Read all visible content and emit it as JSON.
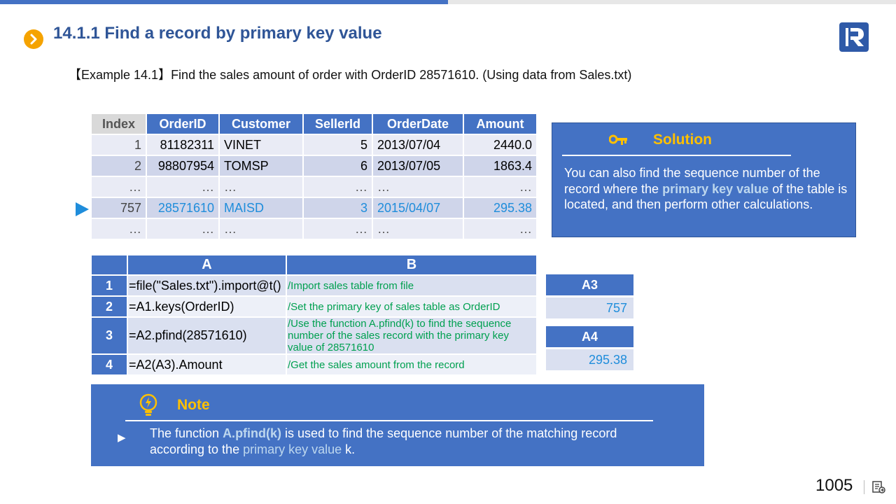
{
  "page": {
    "title": "14.1.1 Find a record by primary key value",
    "example": "【Example 14.1】Find the sales amount of order with OrderID 28571610. (Using data from Sales.txt)",
    "page_number": "1005"
  },
  "data_table": {
    "headers": [
      "Index",
      "OrderID",
      "Customer",
      "SellerId",
      "OrderDate",
      "Amount"
    ],
    "rows": [
      [
        "1",
        "81182311",
        "VINET",
        "5",
        "2013/07/04",
        "2440.0"
      ],
      [
        "2",
        "98807954",
        "TOMSP",
        "6",
        "2013/07/05",
        "1863.4"
      ],
      [
        "…",
        "…",
        "…",
        "…",
        "…",
        "…"
      ],
      [
        "757",
        "28571610",
        "MAISD",
        "3",
        "2015/04/07",
        "295.38"
      ],
      [
        "…",
        "…",
        "…",
        "…",
        "…",
        "…"
      ]
    ]
  },
  "solution": {
    "title": "Solution",
    "text_before": "You can also find the sequence number of the record where the ",
    "highlight": "primary key value",
    "text_after": " of the table is located, and then perform other calculations."
  },
  "code_grid": {
    "col_a": "A",
    "col_b": "B",
    "rows": [
      {
        "num": "1",
        "a": "=file(\"Sales.txt\").import@t()",
        "b": "/Import sales table from file"
      },
      {
        "num": "2",
        "a": "=A1.keys(OrderID)",
        "b": "/Set the primary key of sales table as OrderID"
      },
      {
        "num": "3",
        "a": "=A2.pfind(28571610)",
        "b": "/Use the function A.pfind(k) to find the sequence number of the sales record with the primary key value of 28571610"
      },
      {
        "num": "4",
        "a": "=A2(A3).Amount",
        "b": "/Get the sales amount from the record"
      }
    ]
  },
  "results": {
    "a3_label": "A3",
    "a3_value": "757",
    "a4_label": "A4",
    "a4_value": "295.38"
  },
  "note": {
    "title": "Note",
    "text_1": "The function ",
    "func": "A.pfind(k)",
    "text_2": " is used to find the sequence number of the matching record according to the ",
    "term": "primary key value",
    "text_3": " k."
  },
  "colors": {
    "accent_blue": "#4472c4",
    "title_blue": "#2f5597",
    "highlight_blue": "#1f8ddb",
    "comment_green": "#00a050",
    "label_gold": "#ffc000"
  }
}
